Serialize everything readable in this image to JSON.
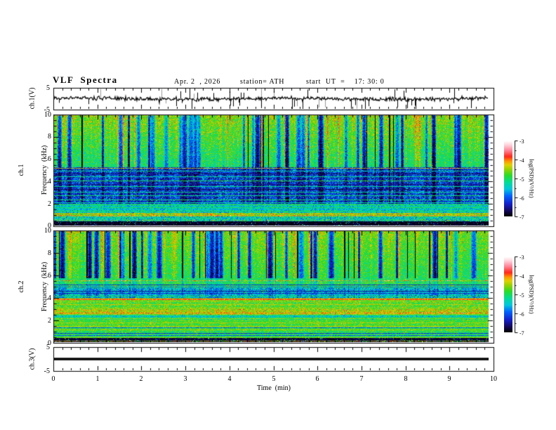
{
  "header": {
    "title": "VLF  Spectra",
    "date": "Apr. 2  , 2026",
    "station": "station= ATH",
    "start_ut": "start  UT  =    17: 30: 0"
  },
  "axes": {
    "time_label": "Time  (min)",
    "time_ticks": [
      "0",
      "1",
      "2",
      "3",
      "4",
      "5",
      "6",
      "7",
      "8",
      "9",
      "10"
    ],
    "freq_ticks": [
      "10",
      "8",
      "6",
      "4",
      "2",
      "0"
    ],
    "volt_ticks": [
      "5",
      "-5"
    ],
    "ch1_wave_label": "ch.1(V)",
    "ch3_wave_label": "ch.3(V)",
    "ch1_spec_label_line1": "ch.1",
    "ch2_spec_label_line1": "ch.2",
    "spec_label_line2": "Frequency  (kHz)"
  },
  "colorbar": {
    "label": "log(PSD)(V²/Hz)",
    "ticks": [
      "-3",
      "-4",
      "-5",
      "-6",
      "-7"
    ],
    "range": [
      -7,
      -3
    ],
    "colormap_stops": [
      [
        0.0,
        "#000000"
      ],
      [
        0.07,
        "#14085a"
      ],
      [
        0.16,
        "#1420c8"
      ],
      [
        0.27,
        "#0064ff"
      ],
      [
        0.36,
        "#00c8dc"
      ],
      [
        0.45,
        "#00dc96"
      ],
      [
        0.54,
        "#28dc28"
      ],
      [
        0.62,
        "#96d200"
      ],
      [
        0.68,
        "#e1d200"
      ],
      [
        0.73,
        "#ff9600"
      ],
      [
        0.79,
        "#ff2819"
      ],
      [
        0.87,
        "#ff8296"
      ],
      [
        0.94,
        "#ffcdd7"
      ],
      [
        1.0,
        "#ffffff"
      ]
    ]
  },
  "chart_data": [
    {
      "panel": "ch1-waveform",
      "type": "line",
      "ylabel": "ch.1(V)",
      "x_range_min": [
        0,
        10
      ],
      "y_range_v": [
        -5,
        5
      ],
      "data_end_min": 9.87,
      "baseline_v": 0,
      "noise_sigma_v": 0.5,
      "spike_count": 46,
      "spike_amp_v": [
        1.8,
        5.2
      ],
      "description": "zero-mean broadband noise about 0 V with frequent impulsive sferic spikes reaching +/-5 V"
    },
    {
      "panel": "ch1-spectrogram",
      "type": "heatmap",
      "ylabel": "ch.1 Frequency (kHz)",
      "x_range_min": [
        0,
        10
      ],
      "y_range_khz": [
        0,
        10
      ],
      "z_label": "log(PSD)(V²/Hz)",
      "z_range": [
        -7,
        -3
      ],
      "data_end_min": 9.87,
      "bands": [
        {
          "f": [
            5.3,
            10.0
          ],
          "level": -5.05,
          "level_hi": -4.55,
          "noise": 0.28,
          "desc": "green/yellow background with dense dark-blue and black vertical sferic streaks"
        },
        {
          "f": [
            2.0,
            5.3
          ],
          "level": -6.15,
          "noise": 0.38,
          "desc": "dark blue band with cyan speckle and horizontal carrier lines"
        },
        {
          "f": [
            1.15,
            2.0
          ],
          "level": -5.45,
          "noise": 0.3,
          "desc": "cyan speckle band"
        },
        {
          "f": [
            0.8,
            1.15
          ],
          "level": -4.5,
          "noise": 0.35,
          "desc": "yellow-green band"
        },
        {
          "f": [
            0.38,
            0.8
          ],
          "level": -5.35,
          "noise": 0.4,
          "desc": "cyan-blue speckle"
        },
        {
          "f": [
            0.0,
            0.38
          ],
          "level": -6.9,
          "noise": 0.15,
          "speck": {
            "p": 0.05,
            "level": -5.3,
            "spread": 1.0
          },
          "desc": "black low-frequency band"
        }
      ],
      "lines": [
        {
          "f": 5.22,
          "level": -4.35,
          "noise": 0.5
        },
        {
          "f": 4.95,
          "level": -5.3
        },
        {
          "f": 4.7,
          "level": -6.7
        },
        {
          "f": 4.45,
          "level": -5.25
        },
        {
          "f": 4.05,
          "level": -4.95
        },
        {
          "f": 3.75,
          "level": -6.6
        },
        {
          "f": 3.55,
          "level": -5.2
        },
        {
          "f": 3.25,
          "level": -6.75
        },
        {
          "f": 3.0,
          "level": -5.25
        },
        {
          "f": 2.7,
          "level": -5.15
        },
        {
          "f": 2.35,
          "level": -5.05
        },
        {
          "f": 2.1,
          "level": -5.3
        },
        {
          "f": 1.9,
          "level": -4.9
        },
        {
          "f": 1.6,
          "level": -5.0
        },
        {
          "f": 1.3,
          "level": -4.95
        },
        {
          "f": 0.95,
          "level": -4.35,
          "noise": 0.45,
          "w": 2
        },
        {
          "f": 0.5,
          "level": -5.0,
          "noise": 0.6
        }
      ],
      "texture": {
        "f_full": 5.3,
        "f_ext": 2.0,
        "ext_k": 0.35,
        "p_black": 0.06,
        "p_blue": 0.1,
        "p_yellow": 0.08
      }
    },
    {
      "panel": "ch2-spectrogram",
      "type": "heatmap",
      "ylabel": "ch.2 Frequency (kHz)",
      "x_range_min": [
        0,
        10
      ],
      "y_range_khz": [
        0,
        10
      ],
      "z_label": "log(PSD)(V²/Hz)",
      "z_range": [
        -7,
        -3
      ],
      "data_end_min": 9.87,
      "bands": [
        {
          "f": [
            5.75,
            10.0
          ],
          "level": -4.95,
          "level_hi": -4.6,
          "noise": 0.24,
          "desc": "green background with deep-blue vertical streak clusters"
        },
        {
          "f": [
            4.85,
            5.75
          ],
          "level": -4.95,
          "noise": 0.3,
          "desc": "green with dark horizontal lines"
        },
        {
          "f": [
            4.0,
            4.85
          ],
          "level": -5.55,
          "noise": 0.35,
          "desc": "cyan-blue band"
        },
        {
          "f": [
            2.95,
            4.0
          ],
          "level": -4.75,
          "noise": 0.3,
          "desc": "green with yellow speckle"
        },
        {
          "f": [
            2.5,
            2.95
          ],
          "level": -4.45,
          "noise": 0.3,
          "desc": "yellow-orange band"
        },
        {
          "f": [
            2.0,
            2.5
          ],
          "level": -5.15,
          "noise": 0.3,
          "desc": "cyan-green band"
        },
        {
          "f": [
            1.0,
            2.0
          ],
          "level": -4.8,
          "noise": 0.25,
          "desc": "green with thin olive lines"
        },
        {
          "f": [
            0.35,
            1.0
          ],
          "level": -4.95,
          "noise": 0.3,
          "desc": "green-cyan with dark rows"
        },
        {
          "f": [
            0.0,
            0.35
          ],
          "level": -6.85,
          "noise": 0.18,
          "speck": {
            "p": 0.05,
            "level": -5.0,
            "spread": 0.8
          },
          "desc": "black bottom band with dark-red base line"
        }
      ],
      "lines": [
        {
          "f": 5.55,
          "level": -4.3,
          "noise": 0.55
        },
        {
          "f": 5.15,
          "level": -6.3
        },
        {
          "f": 5.0,
          "level": -5.9
        },
        {
          "f": 4.6,
          "level": -6.5
        },
        {
          "f": 4.4,
          "level": -6.3
        },
        {
          "f": 4.15,
          "level": -5.0
        },
        {
          "f": 3.9,
          "level": -3.95,
          "w": 2,
          "noise": 0.15
        },
        {
          "f": 3.72,
          "level": -4.5
        },
        {
          "f": 3.4,
          "level": -4.4
        },
        {
          "f": 3.1,
          "level": -4.45
        },
        {
          "f": 2.62,
          "level": -4.05,
          "noise": 0.3
        },
        {
          "f": 2.3,
          "level": -5.6
        },
        {
          "f": 2.15,
          "level": -4.55
        },
        {
          "f": 1.75,
          "level": -4.45
        },
        {
          "f": 1.45,
          "level": -4.4
        },
        {
          "f": 1.3,
          "level": -5.9
        },
        {
          "f": 1.12,
          "level": -4.55
        },
        {
          "f": 0.8,
          "level": -6.2
        },
        {
          "f": 0.6,
          "level": -6.0
        },
        {
          "f": 0.42,
          "level": -4.6
        },
        {
          "f": 0.07,
          "level": -4.4,
          "noise": 0.5
        }
      ],
      "texture": {
        "f_full": 5.75,
        "f_ext": 4.0,
        "ext_k": 0.2,
        "p_black": 0.055,
        "p_blue": 0.11,
        "p_yellow": 0.07
      }
    },
    {
      "panel": "ch3-waveform",
      "type": "line",
      "ylabel": "ch.3(V)",
      "x_range_min": [
        0,
        10
      ],
      "y_range_v": [
        -5,
        5
      ],
      "data_end_min": 9.87,
      "signal_v": 0,
      "description": "constant 0 V flat thick line (no signal on channel 3)"
    }
  ]
}
